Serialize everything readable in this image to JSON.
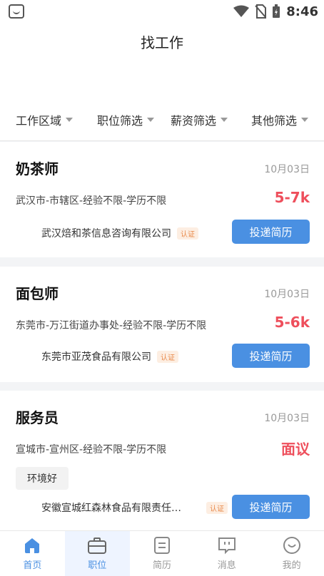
{
  "status": {
    "time": "8:46"
  },
  "header": {
    "title": "找工作"
  },
  "filters": [
    "工作区域",
    "职位筛选",
    "薪资筛选",
    "其他筛选"
  ],
  "jobs": [
    {
      "title": "奶茶师",
      "date": "10月03日",
      "meta": "武汉市-市辖区-经验不限-学历不限",
      "salary": "5-7k",
      "company": "武汉焙和茶信息咨询有限公司",
      "badge": "认证",
      "apply": "投递简历"
    },
    {
      "title": "面包师",
      "date": "10月03日",
      "meta": "东莞市-万江街道办事处-经验不限-学历不限",
      "salary": "5-6k",
      "company": "东莞市亚茂食品有限公司",
      "badge": "认证",
      "apply": "投递简历"
    },
    {
      "title": "服务员",
      "date": "10月03日",
      "meta": "宣城市-宣州区-经验不限-学历不限",
      "salary": "面议",
      "tag": "环境好",
      "company": "安徽宣城红森林食品有限责任…",
      "badge": "认证",
      "apply": "投递简历"
    }
  ],
  "nav": [
    {
      "label": "首页",
      "icon": "home-icon"
    },
    {
      "label": "职位",
      "icon": "briefcase-icon"
    },
    {
      "label": "简历",
      "icon": "resume-icon"
    },
    {
      "label": "消息",
      "icon": "message-icon"
    },
    {
      "label": "我的",
      "icon": "profile-icon"
    }
  ],
  "colors": {
    "accent": "#4a90e2",
    "salary": "#ee4f5c",
    "badge": "#e8894a"
  }
}
